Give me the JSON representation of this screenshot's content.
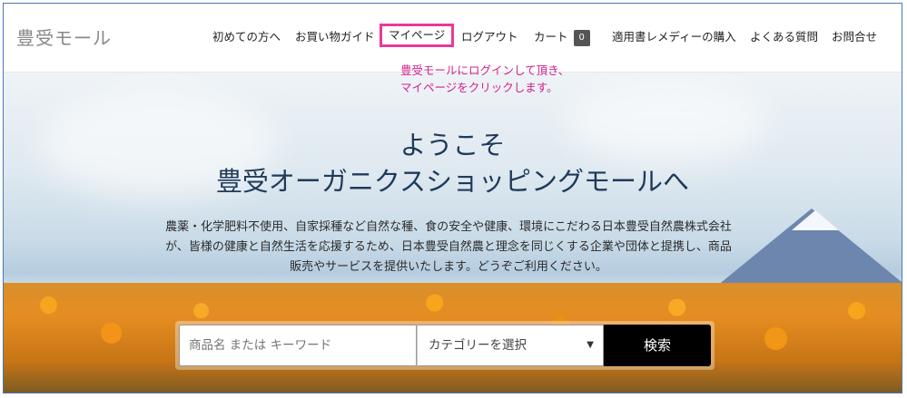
{
  "header": {
    "logo": "豊受モール",
    "nav": [
      {
        "label": "初めての方へ"
      },
      {
        "label": "お買い物ガイド"
      },
      {
        "label": "マイページ"
      },
      {
        "label": "ログアウト"
      },
      {
        "label": "カート"
      },
      {
        "label": "適用書レメディーの購入"
      },
      {
        "label": "よくある質問"
      },
      {
        "label": "お問合せ"
      }
    ],
    "cart_count": "0"
  },
  "annotation": {
    "line1": "豊受モールにログインして頂き、",
    "line2": "マイページをクリックします。",
    "color": "#e8399b"
  },
  "hero": {
    "title_line1": "ようこそ",
    "title_line2": "豊受オーガニクスショッピングモールへ",
    "desc_line1": "農薬・化学肥料不使用、自家採種など自然な種、食の安全や健康、環境にこだわる日本豊受自然農株式会社",
    "desc_line2": "が、皆様の健康と自然生活を応援するため、日本豊受自然農と理念を同じくする企業や団体と提携し、商品",
    "desc_line3": "販売やサービスを提供いたします。どうぞご利用ください。"
  },
  "search": {
    "placeholder": "商品名 または キーワード",
    "category_selected": "カテゴリーを選択",
    "button_label": "検索"
  }
}
